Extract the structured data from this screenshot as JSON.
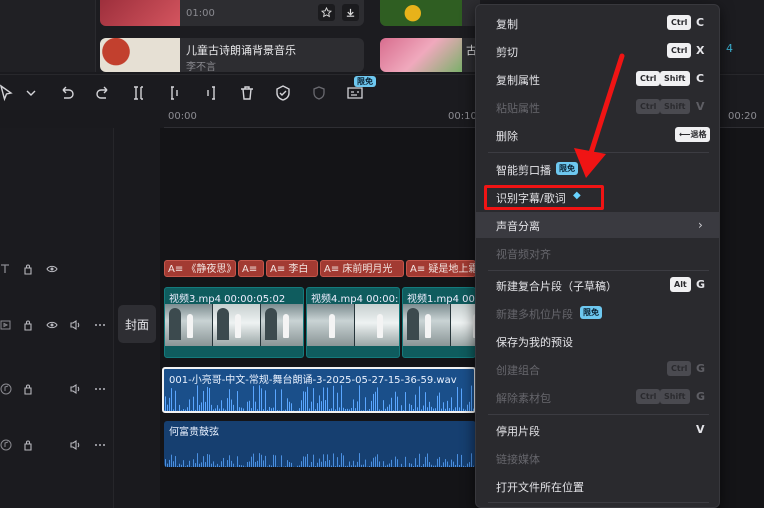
{
  "media_library": {
    "card1": {
      "duration": "01:00"
    },
    "card2": {
      "title": "儿童古诗朗诵背景音乐",
      "artist": "李不言"
    },
    "card3": {
      "title": "古"
    },
    "side_number": "4"
  },
  "toolbar": {
    "badge": "限免"
  },
  "ruler": {
    "labels": [
      "00:00",
      "00:10",
      "00:20"
    ]
  },
  "tracks": {
    "cover_label": "封面",
    "text_clips": [
      "A≡ 《静夜思》",
      "A≡",
      "A≡ 李白",
      "A≡ 床前明月光",
      "A≡ 疑是地上霜"
    ],
    "video_clips": [
      {
        "label": "视频3.mp4  00:00:05:02"
      },
      {
        "label": "视频4.mp4  00:00:0"
      },
      {
        "label": "视频1.mp4  00"
      }
    ],
    "audio_main": "001-小亮哥-中文-常规-舞台朗诵-3-2025-05-27-15-36-59.wav",
    "audio_bgm": "何富贵鼓弦"
  },
  "menu": {
    "copy": {
      "label": "复制",
      "mod": "Ctrl",
      "key": "C"
    },
    "cut": {
      "label": "剪切",
      "mod": "Ctrl",
      "key": "X"
    },
    "copy_attr": {
      "label": "复制属性",
      "mod1": "Ctrl",
      "mod2": "Shift",
      "key": "C"
    },
    "paste_attr": {
      "label": "粘贴属性",
      "mod1": "Ctrl",
      "mod2": "Shift",
      "key": "V"
    },
    "delete": {
      "label": "删除",
      "key": "⟵退格"
    },
    "smart_cut": {
      "label": "智能剪口播",
      "badge": "限免"
    },
    "recognize": {
      "label": "识别字幕/歌词"
    },
    "voice_sep": {
      "label": "声音分离"
    },
    "align": {
      "label": "视音频对齐"
    },
    "new_compound": {
      "label": "新建复合片段（子草稿）",
      "mod": "Alt",
      "key": "G"
    },
    "new_multicam": {
      "label": "新建多机位片段",
      "badge": "限免"
    },
    "save_preset": {
      "label": "保存为我的预设"
    },
    "create_group": {
      "label": "创建组合",
      "mod": "Ctrl",
      "key": "G"
    },
    "ungroup": {
      "label": "解除素材包",
      "mod1": "Ctrl",
      "mod2": "Shift",
      "key": "G"
    },
    "disable_clip": {
      "label": "停用片段",
      "key": "V"
    },
    "link_media": {
      "label": "链接媒体"
    },
    "open_location": {
      "label": "打开文件所在位置"
    }
  },
  "colors": {
    "annotation": "#f01414",
    "accent_badge": "#6ec8f0",
    "text_clip": "#a23a32",
    "video_clip": "#0f5c5e",
    "audio_clip": "#1a4f8a"
  }
}
